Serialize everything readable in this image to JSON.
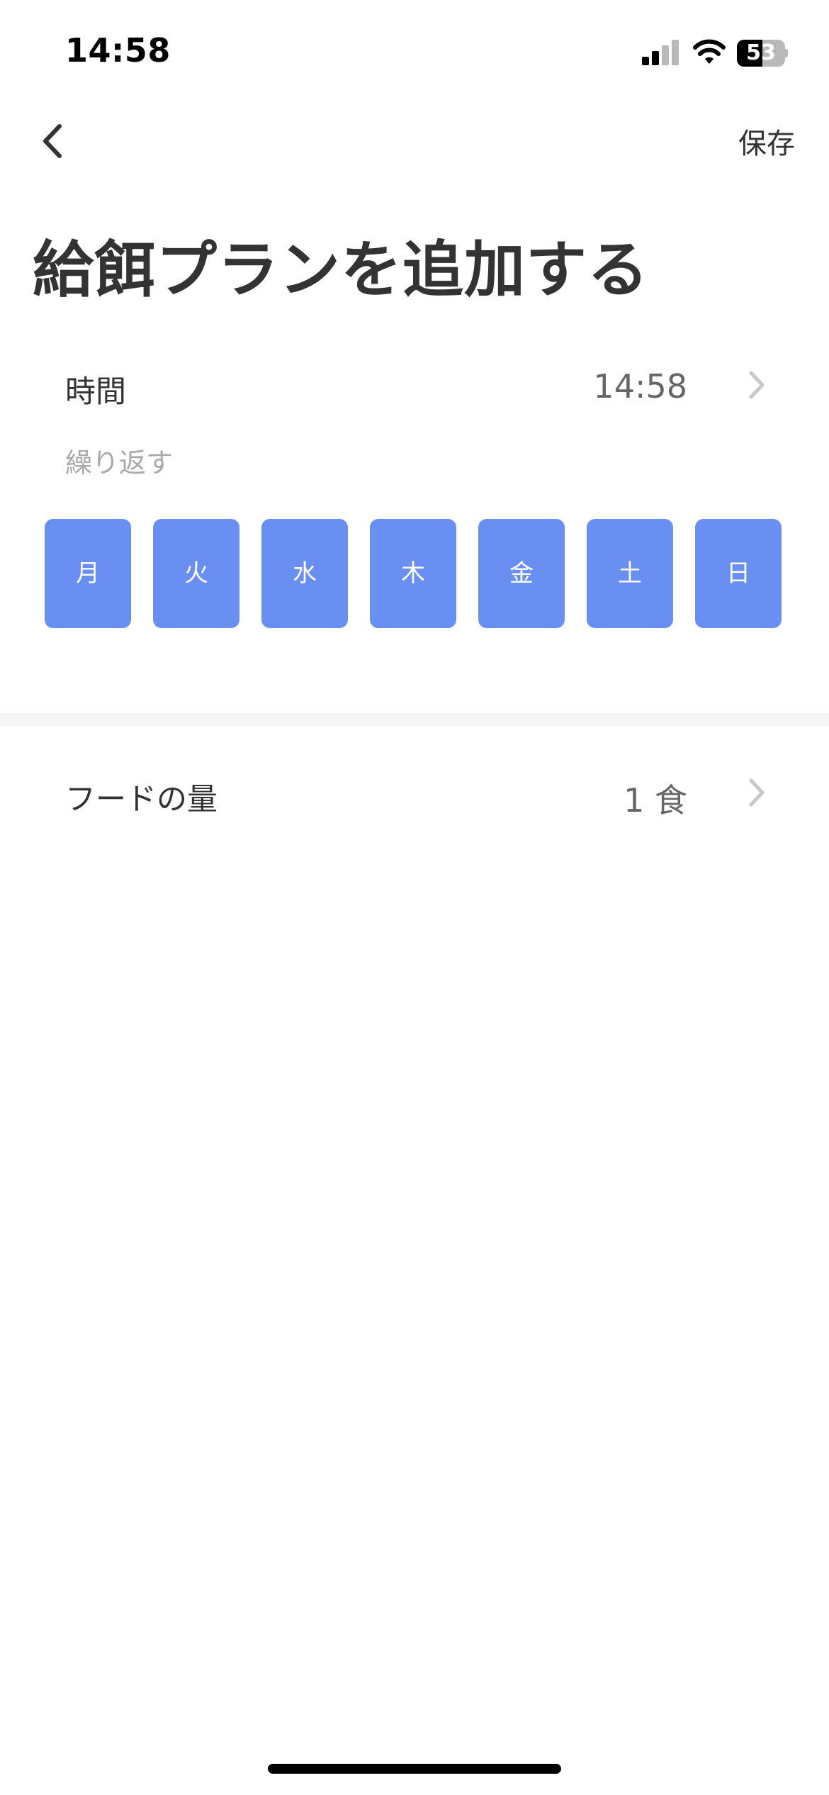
{
  "status_bar": {
    "time": "14:58",
    "battery_level": 53,
    "battery_text": "53",
    "signal_bars_active": 2,
    "icons": [
      "cellular-signal-icon",
      "wifi-icon",
      "battery-icon"
    ]
  },
  "nav": {
    "back_icon": "chevron-left-icon",
    "save_label": "保存"
  },
  "title": "給餌プランを追加する",
  "time_row": {
    "label": "時間",
    "value": "14:58",
    "icon": "chevron-right-icon"
  },
  "repeat": {
    "label": "繰り返す",
    "days": [
      {
        "label": "月",
        "selected": true
      },
      {
        "label": "火",
        "selected": true
      },
      {
        "label": "水",
        "selected": true
      },
      {
        "label": "木",
        "selected": true
      },
      {
        "label": "金",
        "selected": true
      },
      {
        "label": "土",
        "selected": true
      },
      {
        "label": "日",
        "selected": true
      }
    ]
  },
  "food_row": {
    "label": "フードの量",
    "value": "1 食",
    "icon": "chevron-right-icon"
  },
  "colors": {
    "accent": "#6a8ff2",
    "text": "#333333",
    "muted": "#aaaaaa",
    "divider": "#f5f5f5"
  }
}
